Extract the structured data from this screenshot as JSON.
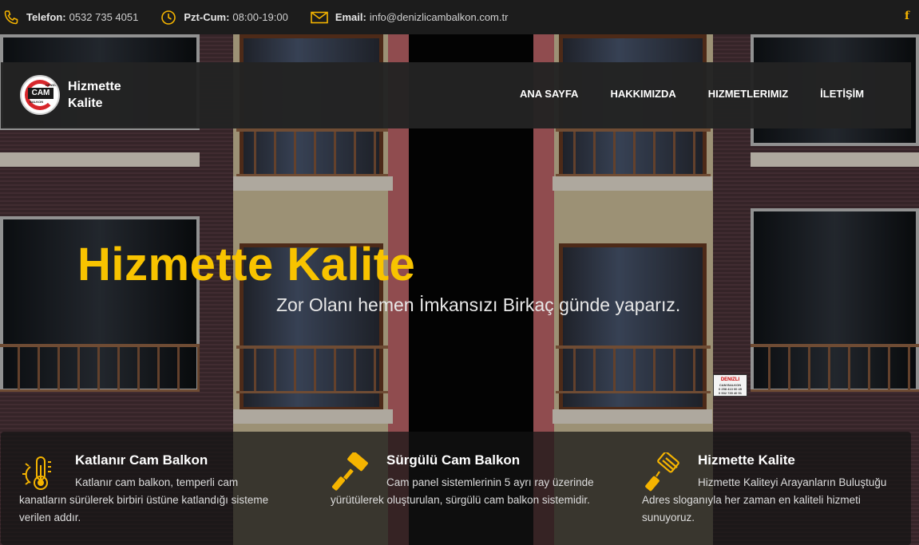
{
  "topbar": {
    "phone_label": "Telefon:",
    "phone_value": "0532 735 4051",
    "hours_label": "Pzt-Cum:",
    "hours_value": "08:00-19:00",
    "email_label": "Email:",
    "email_value": "info@denizlicambalkon.com.tr",
    "social": "f"
  },
  "brand": {
    "logo_top": "DENİZLİ",
    "logo_main": "CAM",
    "logo_sub": "BALKON",
    "name_line1": "Hizmette",
    "name_line2": "Kalite"
  },
  "nav": {
    "items": [
      {
        "label": "ANA SAYFA"
      },
      {
        "label": "HAKKIMIZDA"
      },
      {
        "label": "HIZMETLERIMIZ"
      },
      {
        "label": "İLETİŞİM"
      }
    ]
  },
  "hero": {
    "title": "Hizmette Kalite",
    "subtitle": "Zor Olanı hemen İmkansızı Birkaç günde yaparız."
  },
  "sign": {
    "line1": "DENIZLI",
    "line2": "CAM BALKON",
    "line3": "0 258 413 00 45",
    "line4": "0 532 735 40 51"
  },
  "features": [
    {
      "icon": "thermometer-sun-icon",
      "title": "Katlanır Cam Balkon",
      "text": "Katlanır cam balkon, temperli cam kanatların sürülerek birbiri üstüne katlandığı sisteme verilen addır."
    },
    {
      "icon": "paint-roller-icon",
      "title": "Sürgülü Cam Balkon",
      "text": "Cam panel sistemlerinin 5 ayrı ray üzerinde yürütülerek oluşturulan, sürgülü cam balkon sistemidir."
    },
    {
      "icon": "paint-brush-icon",
      "title": "Hizmette Kalite",
      "text": "Hizmette Kaliteyi Arayanların Buluştuğu Adres sloganıyla her zaman en kaliteli hizmeti sunuyoruz."
    }
  ],
  "colors": {
    "accent": "#f8c300",
    "topbar_bg": "#1c1c1c",
    "navbar_bg": "#232323"
  }
}
